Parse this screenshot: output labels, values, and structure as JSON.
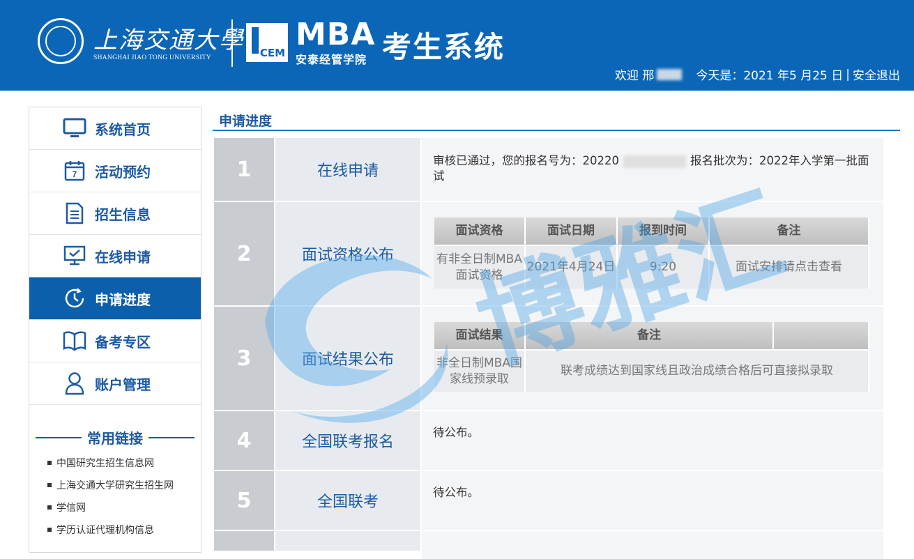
{
  "header": {
    "university_cn": "上海交通大學",
    "university_en": "SHANGHAI JIAO TONG UNIVERSITY",
    "brand_short": "MBA",
    "school_name": "安泰经管学院",
    "logo_box_text": "CEM",
    "system_title": "考生系统",
    "welcome": "欢迎 邢",
    "today": "今天是：2021 年5 月25 日",
    "separator": "|",
    "logout": "安全退出"
  },
  "sidebar": {
    "items": [
      {
        "label": "系统首页",
        "icon": "monitor-icon"
      },
      {
        "label": "活动预约",
        "icon": "calendar-icon"
      },
      {
        "label": "招生信息",
        "icon": "document-icon"
      },
      {
        "label": "在线申请",
        "icon": "screen-check-icon"
      },
      {
        "label": "申请进度",
        "icon": "clock-icon",
        "active": true
      },
      {
        "label": "备考专区",
        "icon": "book-icon"
      },
      {
        "label": "账户管理",
        "icon": "user-icon"
      }
    ],
    "links_title": "常用链接",
    "links": [
      "中国研究生招生信息网",
      "上海交通大学研究生招生网",
      "学信网",
      "学历认证代理机构信息"
    ]
  },
  "main": {
    "title": "申请进度",
    "steps": [
      {
        "num": "1",
        "name": "在线申请",
        "detail_a": "审核已通过，您的报名号为：20220",
        "detail_b": "报名批次为：2022年入学第一批面试"
      },
      {
        "num": "2",
        "name": "面试资格公布"
      },
      {
        "num": "3",
        "name": "面试结果公布"
      },
      {
        "num": "4",
        "name": "全国联考报名",
        "detail": "待公布。"
      },
      {
        "num": "5",
        "name": "全国联考",
        "detail": "待公布。"
      }
    ],
    "interview_table": {
      "headers": [
        "面试资格",
        "面试日期",
        "报到时间",
        "备注"
      ],
      "row": [
        "有非全日制MBA面试资格",
        "2021年4月24日",
        "9:20",
        "面试安排请点击查看"
      ]
    },
    "result_table": {
      "headers": [
        "面试结果",
        "备注"
      ],
      "row": [
        "非全日制MBA国家线预录取",
        "联考成绩达到国家线且政治成绩合格后可直接拟录取"
      ]
    }
  },
  "watermark_text": "博雅汇",
  "colors": {
    "primary": "#0b66b8",
    "active_nav": "#0b5fab",
    "link_blue": "#1d5aa2"
  }
}
